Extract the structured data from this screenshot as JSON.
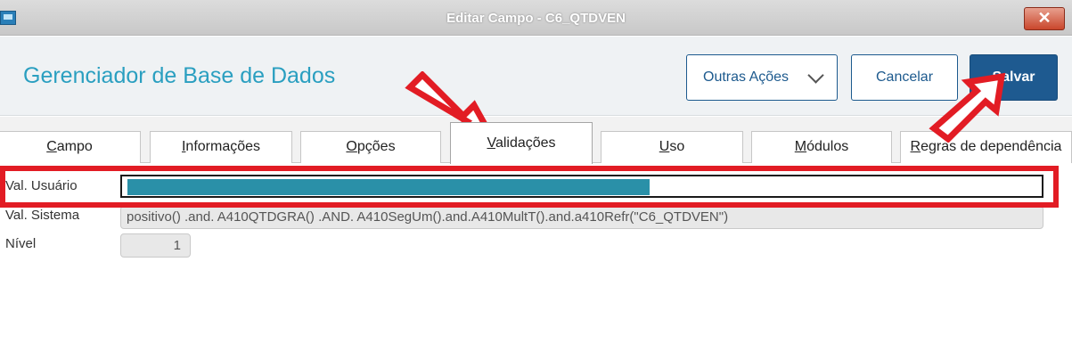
{
  "window": {
    "title": "Editar Campo - C6_QTDVEN",
    "close_label": "✕"
  },
  "header": {
    "title": "Gerenciador de Base de Dados",
    "more_actions_label": "Outras Ações",
    "cancel_label": "Cancelar",
    "save_label": "Salvar"
  },
  "tabs": [
    {
      "first": "C",
      "rest": "ampo"
    },
    {
      "first": "I",
      "rest": "nformações"
    },
    {
      "first": "O",
      "rest": "pções"
    },
    {
      "first": "V",
      "rest": "alidações",
      "active": true
    },
    {
      "first": "U",
      "rest": "so"
    },
    {
      "first": "M",
      "rest": "ódulos"
    },
    {
      "first": "R",
      "rest": "egras de dependência"
    }
  ],
  "form": {
    "user_validation_label": "Val. Usuário",
    "system_validation_label": "Val. Sistema",
    "system_validation_value": "positivo() .and. A410QTDGRA() .AND. A410SegUm().and.A410MultT().and.a410Refr(\"C6_QTDVEN\")",
    "level_label": "Nível",
    "level_value": "1"
  },
  "colors": {
    "accent": "#2a9fc0",
    "primary": "#1e5a90",
    "annotation": "#e21c24"
  }
}
